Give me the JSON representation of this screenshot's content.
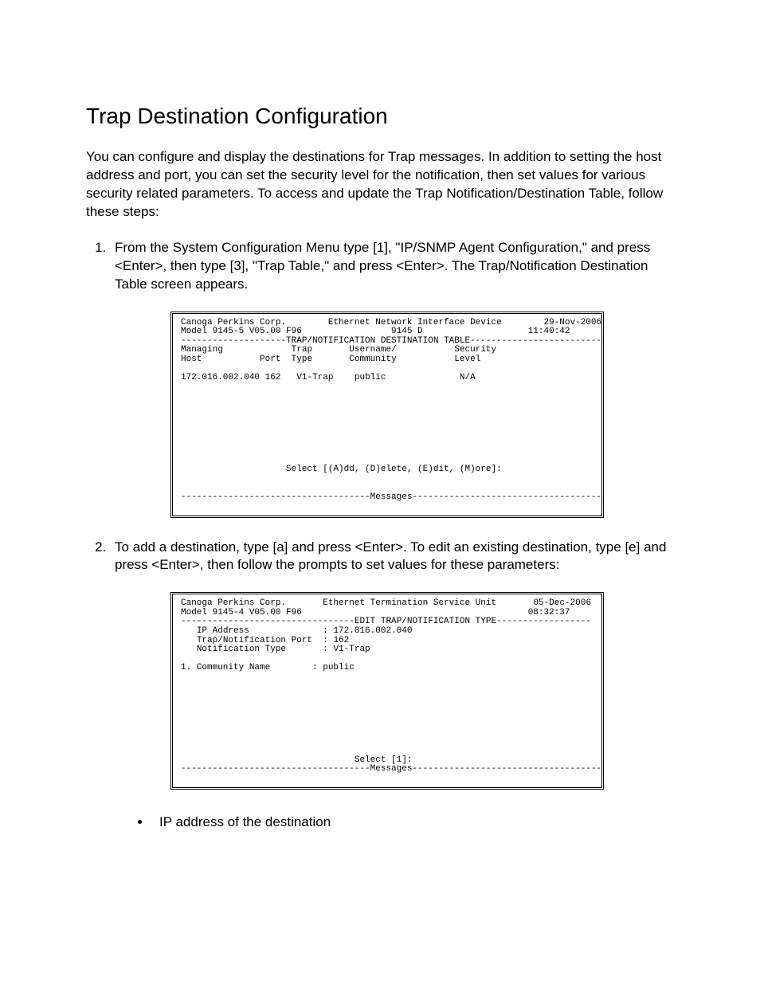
{
  "title": "Trap Destination Configuration",
  "intro": "You can configure and display the destinations for Trap messages.  In addition to setting the host address and port, you can set the security level for the notification, then set values for various security related parameters.  To access and update the Trap Notification/Destination Table, follow these steps:",
  "steps": {
    "s1": "From the System Configuration Menu type [1], \"IP/SNMP Agent Configuration,\" and press <Enter>, then type [3], \"Trap Table,\" and press <Enter>.  The Trap/Notification Destination Table screen appears.",
    "s2": "To add a destination, type [a] and press <Enter>.  To edit an existing destination, type [e] and press <Enter>, then follow the prompts to set values for these parameters:"
  },
  "terminal1": {
    "header_left": "Canoga Perkins Corp.",
    "header_center": "Ethernet Network Interface Device",
    "header_date": "29-Nov-2006",
    "model_line_left": "Model 9145-5 V05.00 F96",
    "model_line_center": "9145 D",
    "header_time": "11:40:42",
    "section_title": "TRAP/NOTIFICATION DESTINATION TABLE",
    "columns": {
      "managing": "Managing",
      "host": "Host",
      "port": "Port",
      "trap": "Trap",
      "type": "Type",
      "username": "Username/",
      "community": "Community",
      "security": "Security",
      "level": "Level"
    },
    "row": {
      "host": "172.016.002.040",
      "port": "162",
      "type": "V1-Trap",
      "community": "public",
      "level": "N/A"
    },
    "prompt": "Select [(A)dd, (D)elete, (E)dit, (M)ore]:",
    "messages_label": "Messages"
  },
  "terminal2": {
    "header_left": "Canoga Perkins Corp.",
    "header_center": "Ethernet Termination Service Unit",
    "header_date": "05-Dec-2006",
    "model_line_left": "Model 9145-4 V05.00 F96",
    "header_time": "08:32:37",
    "section_title": "EDIT TRAP/NOTIFICATION TYPE",
    "fields": {
      "ip_label": "IP Address",
      "ip_value": "172.016.002.040",
      "port_label": "Trap/Notification Port",
      "port_value": "162",
      "ntype_label": "Notification Type",
      "ntype_value": "V1-Trap",
      "cname_label": "1. Community Name",
      "cname_value": "public"
    },
    "prompt": "Select [1]:",
    "messages_label": "Messages"
  },
  "bullet1": "IP address of the destination"
}
